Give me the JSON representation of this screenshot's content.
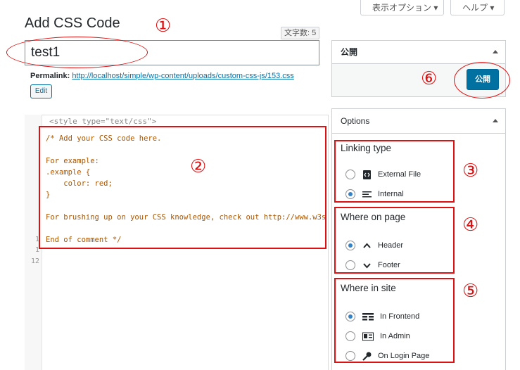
{
  "header": {
    "screen_options_label": "表示オプション ▾",
    "help_label": "ヘルプ ▾"
  },
  "page": {
    "title": "Add CSS Code",
    "char_count": "文字数: 5"
  },
  "annotations": {
    "n1": "①",
    "n2": "②",
    "n3": "③",
    "n4": "④",
    "n5": "⑤",
    "n6": "⑥"
  },
  "title_field": {
    "value": "test1"
  },
  "permalink": {
    "label": "Permalink:",
    "url": "http://localhost/simple/wp-content/uploads/custom-css-js/153.css",
    "edit_label": "Edit"
  },
  "editor": {
    "style_tag": "<style type=\"text/css\">",
    "line_numbers": [
      "1",
      "1",
      "12"
    ],
    "code_lines": [
      "/* Add your CSS code here.",
      "",
      "For example:",
      ".example {",
      "    color: red;",
      "}",
      "",
      "For brushing up on your CSS knowledge, check out http://www.w3s",
      "",
      "End of comment */"
    ]
  },
  "publish_box": {
    "title": "公開",
    "button_label": "公開"
  },
  "options_box": {
    "title": "Options",
    "linking_type": {
      "title": "Linking type",
      "options": [
        {
          "label": "External File",
          "selected": false,
          "icon": "code-file-icon"
        },
        {
          "label": "Internal",
          "selected": true,
          "icon": "text-lines-icon"
        }
      ]
    },
    "where_on_page": {
      "title": "Where on page",
      "options": [
        {
          "label": "Header",
          "selected": true,
          "icon": "chevron-up-icon"
        },
        {
          "label": "Footer",
          "selected": false,
          "icon": "chevron-down-icon"
        }
      ]
    },
    "where_in_site": {
      "title": "Where in site",
      "options": [
        {
          "label": "In Frontend",
          "selected": true,
          "icon": "frontend-grid-icon"
        },
        {
          "label": "In Admin",
          "selected": false,
          "icon": "admin-card-icon"
        },
        {
          "label": "On Login Page",
          "selected": false,
          "icon": "key-icon"
        }
      ]
    }
  },
  "colors": {
    "annotation_red": "#dd1111",
    "primary_blue": "#0071a1",
    "link_blue": "#0073aa"
  }
}
